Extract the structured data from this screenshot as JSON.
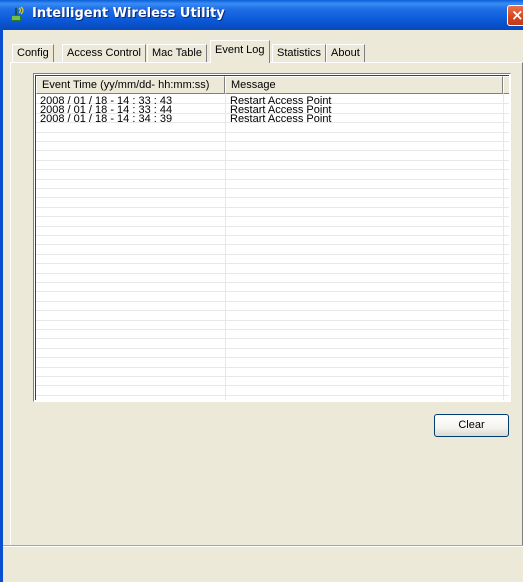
{
  "window": {
    "title": "Intelligent Wireless Utility",
    "close_symbol": "×"
  },
  "tabs": [
    {
      "label": "Config"
    },
    {
      "label": "Access Control"
    },
    {
      "label": "Mac Table"
    },
    {
      "label": "Event Log",
      "active": true
    },
    {
      "label": "Statistics"
    },
    {
      "label": "About"
    }
  ],
  "event_log": {
    "columns": [
      "Event Time (yy/mm/dd- hh:mm:ss)",
      "Message"
    ],
    "rows": [
      [
        "2008 / 01 / 18 - 14 : 33 : 43",
        "Restart Access Point"
      ],
      [
        "2008 / 01 / 18 - 14 : 33 : 44",
        "Restart Access Point"
      ],
      [
        "2008 / 01 / 18 - 14 : 34 : 39",
        "Restart Access Point"
      ]
    ]
  },
  "buttons": {
    "clear_label": "Clear"
  },
  "colors": {
    "titlebar": "#0a57d6",
    "window_bg": "#ece9d8",
    "close_button": "#d4451f"
  }
}
